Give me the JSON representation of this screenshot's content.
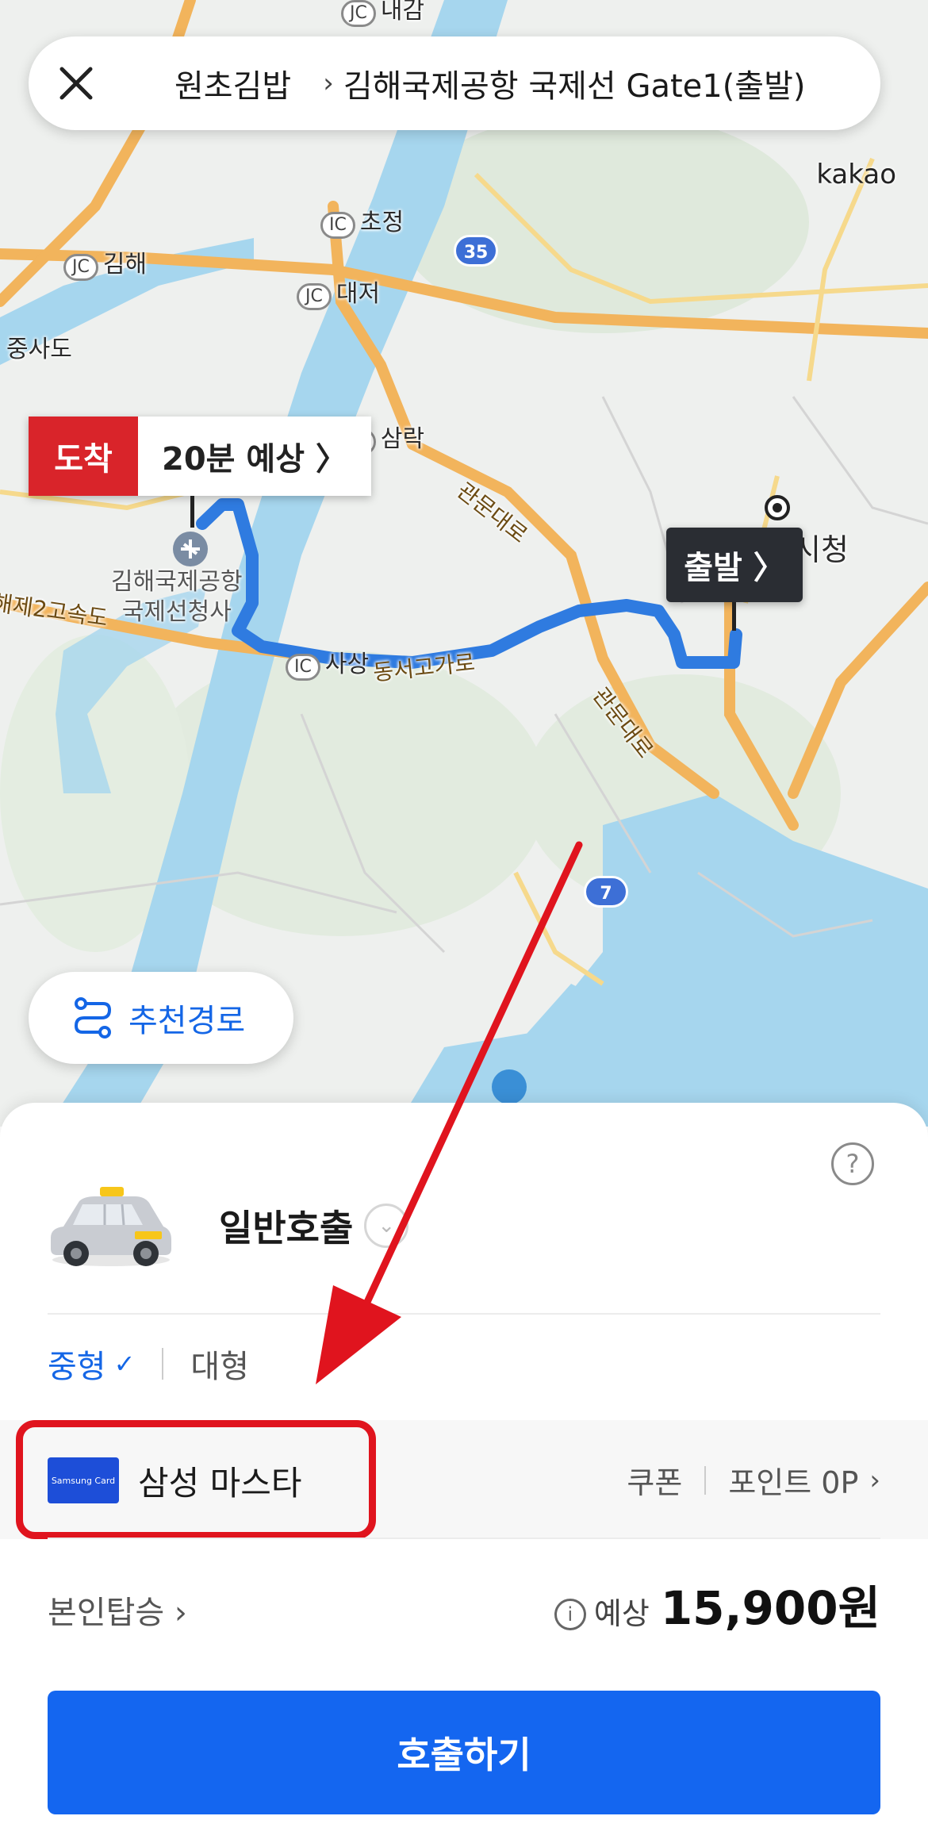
{
  "header": {
    "origin": "원초김밥",
    "separator": "›",
    "destination": "김해국제공항 국제선 Gate1(출발)"
  },
  "map": {
    "provider": "kakao",
    "labels": {
      "daejeo_top": "내감",
      "chojeong": "초정",
      "gimhae": "김해",
      "daejeo": "대저",
      "jungsado": "중사도",
      "samrak": "삼락",
      "airport": "김해국제공항\n국제선청사",
      "sasang": "사상",
      "city_hall": "시청",
      "road_gwanmun1": "관문대로",
      "road_gwanmun2": "관문대로",
      "road_dongseo": "동서고가로",
      "road_gimhae2": "해제2고속도",
      "ic": "IC",
      "jc": "JC",
      "route_35": "35",
      "route_7": "7"
    },
    "arrival_tag": "도착",
    "arrival_eta": "20분 예상 〉",
    "depart_label": "출발 〉",
    "route_chip_label": "추천경로"
  },
  "sheet": {
    "service_name": "일반호출",
    "size_selected": "중형",
    "size_other": "대형",
    "payment_card_logo_text": "Samsung Card",
    "payment_name": "삼성 마스타",
    "coupon_label": "쿠폰",
    "point_label": "포인트 0P",
    "self_ride": "본인탑승 ›",
    "fare_prefix": "예상",
    "fare": "15,900원",
    "call_button": "호출하기",
    "help_icon": "?"
  },
  "colors": {
    "primary": "#1466f0",
    "arrival_red": "#d9242a",
    "route_blue": "#2f7be0",
    "annotation_red": "#e0141e"
  }
}
